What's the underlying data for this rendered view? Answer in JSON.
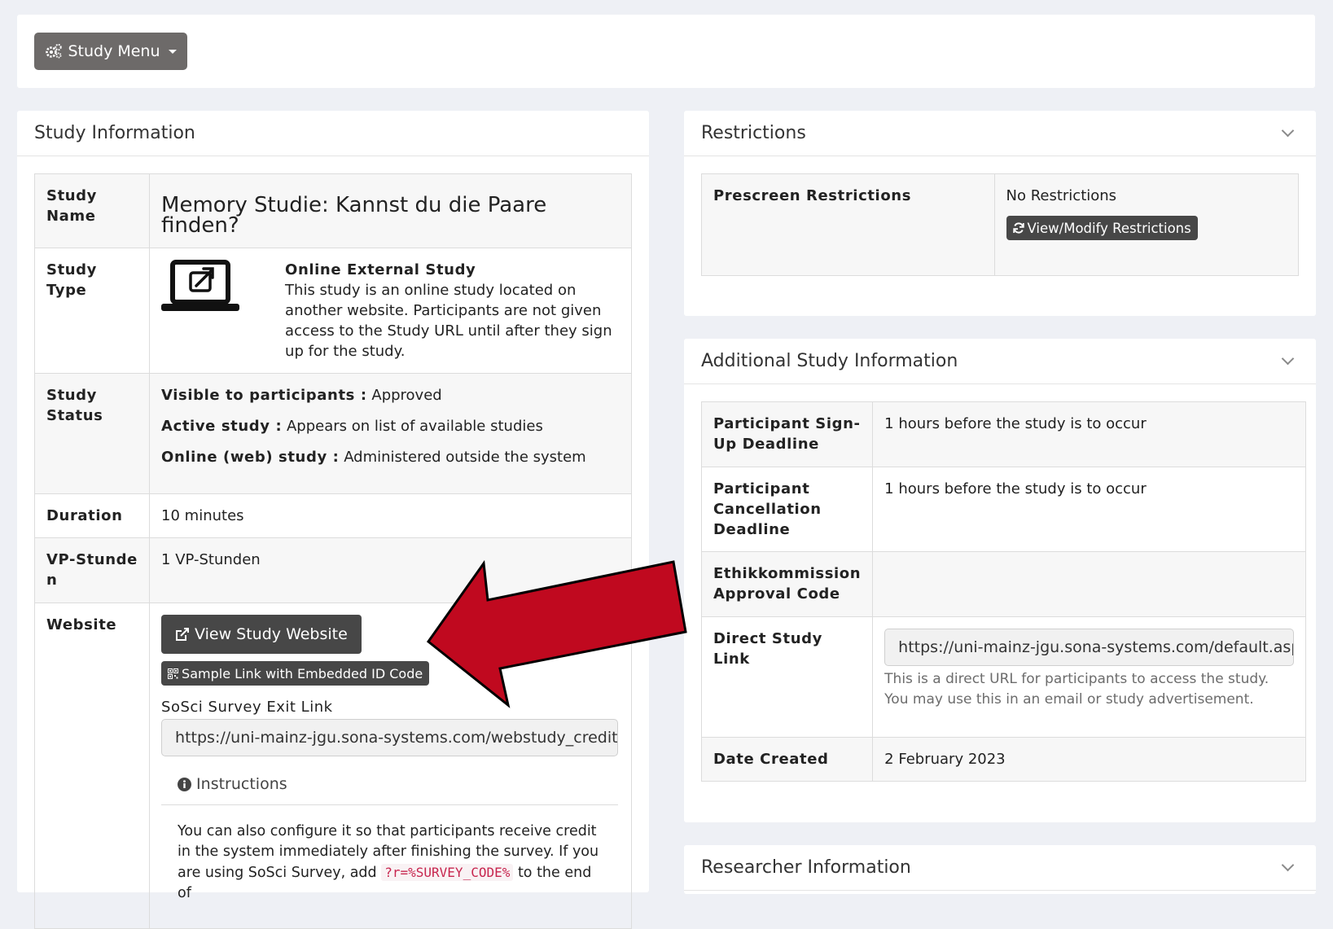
{
  "topbar": {
    "study_menu_label": "Study Menu"
  },
  "study_info": {
    "title": "Study Information",
    "rows": {
      "name_label": "Study Name",
      "name_value": "Memory Studie: Kannst du die Paare finden?",
      "type_label": "Study Type",
      "type_title": "Online External Study",
      "type_desc": "This study is an online study located on another website. Participants are not given access to the Study URL until after they sign up for the study.",
      "status_label": "Study Status",
      "status_visible_key": "Visible to participants :",
      "status_visible_val": "Approved",
      "status_active_key": "Active study :",
      "status_active_val": "Appears on list of available studies",
      "status_online_key": "Online (web) study :",
      "status_online_val": "Administered outside the system",
      "duration_label": "Duration",
      "duration_value": "10 minutes",
      "vp_label": "VP-Stunden",
      "vp_value": "1 VP-Stunden",
      "website_label": "Website",
      "view_website_btn": "View Study Website",
      "sample_link_btn": "Sample Link with Embedded ID Code",
      "exit_link_label": "SoSci Survey Exit Link",
      "exit_link_value": "https://uni-mainz-jgu.sona-systems.com/webstudy_credit.",
      "instructions_label": "Instructions",
      "instructions_text_1": "You can also configure it so that participants receive credit in the system immediately after finishing the survey. If you are using SoSci Survey, add",
      "instructions_code": "?r=%SURVEY_CODE%",
      "instructions_text_2": "to the end of"
    }
  },
  "restrictions": {
    "title": "Restrictions",
    "prescreen_label": "Prescreen Restrictions",
    "prescreen_value": "No Restrictions",
    "modify_btn": "View/Modify Restrictions"
  },
  "additional": {
    "title": "Additional Study Information",
    "signup_label": "Participant Sign-Up Deadline",
    "signup_value": "1 hours before the study is to occur",
    "cancel_label": "Participant Cancellation Deadline",
    "cancel_value": "1 hours before the study is to occur",
    "ethik_label": "Ethikkommission Approval Code",
    "ethik_value": "",
    "direct_label": "Direct Study Link",
    "direct_value": "https://uni-mainz-jgu.sona-systems.com/default.asp",
    "direct_help": "This is a direct URL for participants to access the study. You may use this in an email or study advertisement.",
    "created_label": "Date Created",
    "created_value": "2 February 2023"
  },
  "researcher": {
    "title": "Researcher Information"
  },
  "colors": {
    "arrow": "#c0091f",
    "button_dark": "#474747",
    "menu_button": "#6d6a69"
  }
}
